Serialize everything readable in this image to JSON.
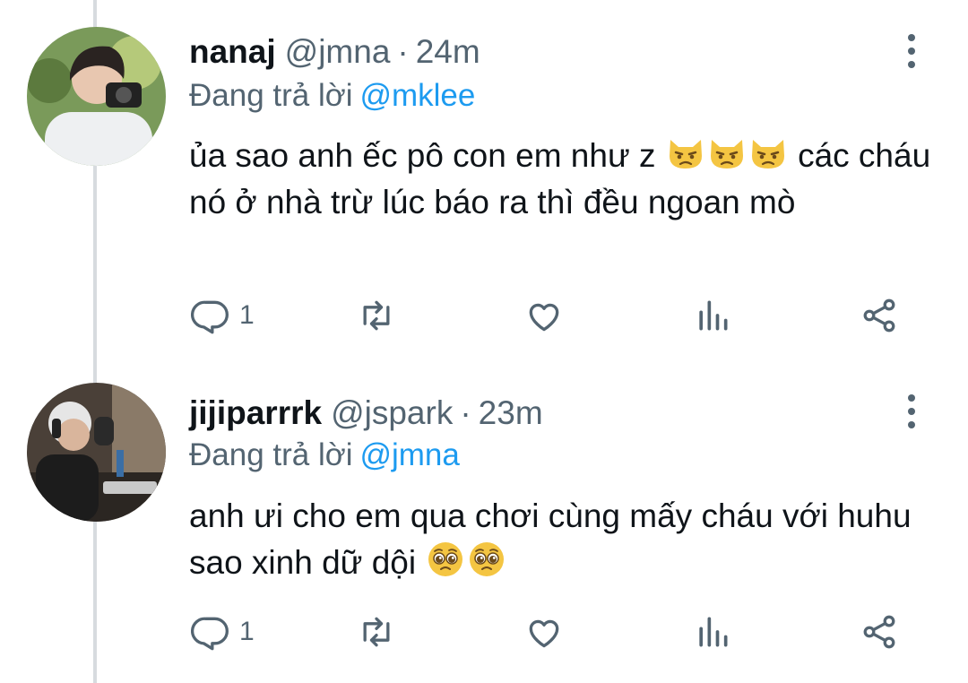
{
  "tweets": [
    {
      "name": "nanaj",
      "handle": "@jmna",
      "separator": "·",
      "time": "24m",
      "replying_prefix": "Đang trả lời",
      "replying_to": "@mklee",
      "text_1": "ủa sao anh ếc pô con em như z",
      "emojis": [
        "pouting-cat-emoji",
        "pouting-cat-emoji",
        "pouting-cat-emoji"
      ],
      "text_2": "các cháu nó ở nhà trừ lúc báo ra thì đều ngoan mò",
      "actions": {
        "reply_count": "1"
      }
    },
    {
      "name": "jijiparrrk",
      "handle": "@jspark",
      "separator": "·",
      "time": "23m",
      "replying_prefix": "Đang trả lời",
      "replying_to": "@jmna",
      "text_1": "anh ưi cho em qua chơi cùng mấy cháu với huhu sao xinh dữ dội",
      "emojis": [
        "pleading-face-emoji",
        "pleading-face-emoji"
      ],
      "actions": {
        "reply_count": "1"
      }
    }
  ],
  "colors": {
    "text": "#0f1419",
    "secondary": "#536471",
    "link": "#1d9bf0",
    "thread_line": "#d7dbdf"
  },
  "icons": [
    "reply-icon",
    "retweet-icon",
    "like-icon",
    "views-icon",
    "share-icon",
    "more-icon"
  ]
}
